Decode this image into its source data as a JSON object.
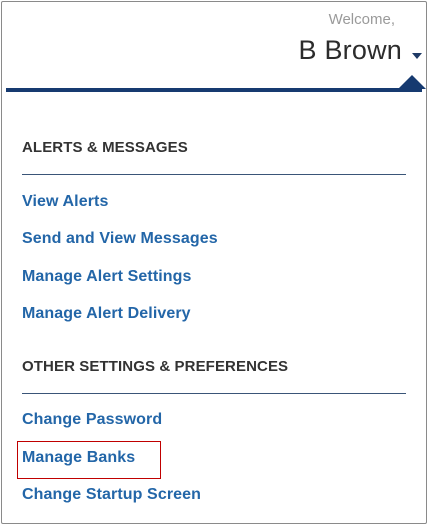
{
  "header": {
    "welcome_label": "Welcome,",
    "username": "B Brown",
    "accent_color": "#163a70"
  },
  "sections": [
    {
      "heading": "ALERTS & MESSAGES",
      "links": [
        "View Alerts",
        "Send and View Messages",
        "Manage Alert Settings",
        "Manage Alert Delivery"
      ]
    },
    {
      "heading": "OTHER SETTINGS & PREFERENCES",
      "links": [
        "Change Password",
        "Manage Banks",
        "Change Startup Screen"
      ]
    }
  ],
  "link_color": "#2366a8",
  "highlight_color": "#c00000",
  "highlighted_item": "Manage Banks"
}
